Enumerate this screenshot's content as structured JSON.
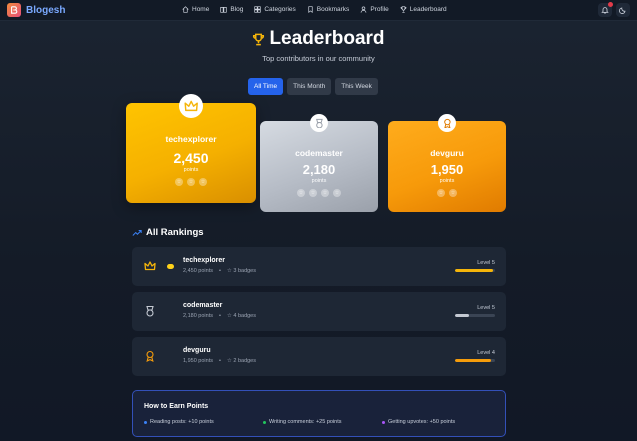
{
  "nav": {
    "brand": "Blogesh",
    "links": [
      {
        "label": "Home",
        "icon": "home-icon"
      },
      {
        "label": "Blog",
        "icon": "book-icon"
      },
      {
        "label": "Categories",
        "icon": "grid-icon"
      },
      {
        "label": "Bookmarks",
        "icon": "bookmark-icon"
      },
      {
        "label": "Profile",
        "icon": "user-icon"
      },
      {
        "label": "Leaderboard",
        "icon": "trophy-icon"
      }
    ]
  },
  "header": {
    "title": "Leaderboard",
    "subtitle": "Top contributors in our community"
  },
  "tabs": [
    {
      "label": "All Time",
      "active": true
    },
    {
      "label": "This Month",
      "active": false
    },
    {
      "label": "This Week",
      "active": false
    }
  ],
  "podium": {
    "first": {
      "name": "techexplorer",
      "points": "2,450",
      "unit": "points",
      "badges": 3
    },
    "second": {
      "name": "codemaster",
      "points": "2,180",
      "unit": "points",
      "badges": 4
    },
    "third": {
      "name": "devguru",
      "points": "1,950",
      "unit": "points",
      "badges": 2
    }
  },
  "rankings": {
    "title": "All Rankings",
    "rows": [
      {
        "name": "techexplorer",
        "points": "2,450 points",
        "sep": "•",
        "badges": "☆ 3 badges",
        "level": "Level 5",
        "progress": 0.95,
        "color": "#f5b50a"
      },
      {
        "name": "codemaster",
        "points": "2,180 points",
        "sep": "•",
        "badges": "☆ 4 badges",
        "level": "Level 5",
        "progress": 0.35,
        "color": "#c4c9d2"
      },
      {
        "name": "devguru",
        "points": "1,950 points",
        "sep": "•",
        "badges": "☆ 2 badges",
        "level": "Level 4",
        "progress": 0.9,
        "color": "#f59c0b"
      }
    ]
  },
  "earn": {
    "title": "How to Earn Points",
    "items": [
      {
        "label": "Reading posts: +10 points",
        "color": "#3b82f6"
      },
      {
        "label": "Writing comments: +25 points",
        "color": "#22c55e"
      },
      {
        "label": "Getting upvotes: +50 points",
        "color": "#a855f7"
      }
    ]
  }
}
